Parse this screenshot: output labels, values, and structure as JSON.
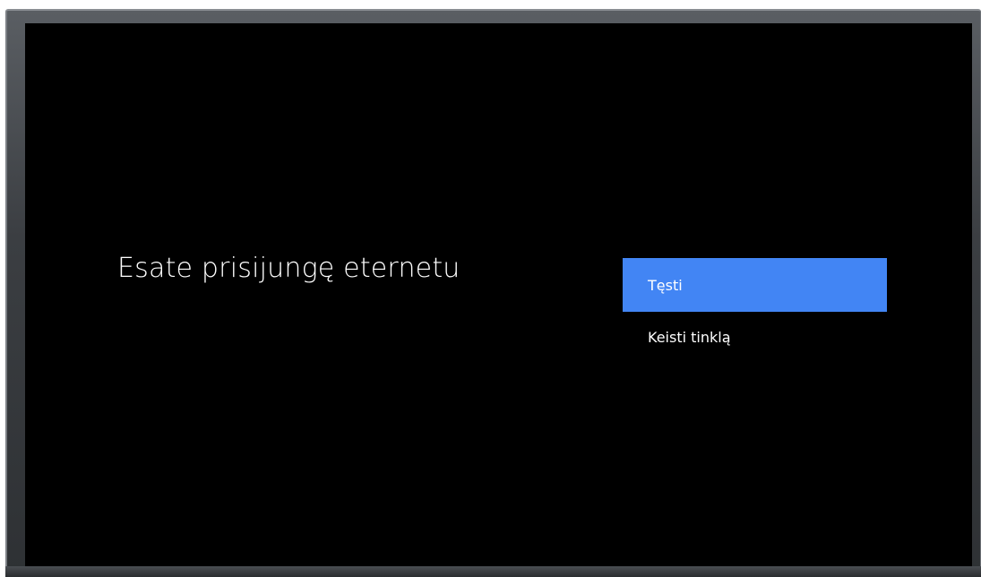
{
  "screen": {
    "title": "Esate prisijungę eternetu"
  },
  "menu": {
    "items": [
      {
        "label": "Tęsti",
        "selected": true
      },
      {
        "label": "Keisti tinklą",
        "selected": false
      }
    ]
  },
  "colors": {
    "background": "#000000",
    "selected_item": "#4285f4",
    "text": "#ffffff",
    "bezel": "#3b3e42"
  }
}
